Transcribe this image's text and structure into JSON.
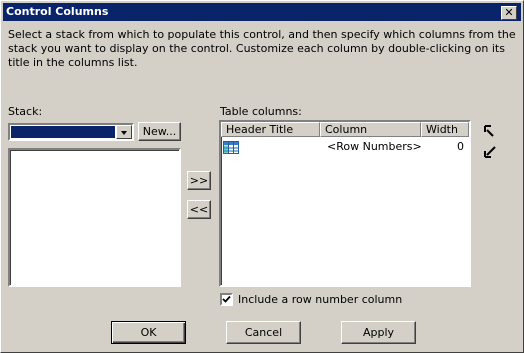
{
  "window": {
    "title": "Control Columns",
    "close_glyph": "✕"
  },
  "description": "Select a stack from which to populate this control, and then specify which columns from the stack you want to display on the control.  Customize each column by double-clicking on its title in the columns list.",
  "stack": {
    "label": "Stack:",
    "selected": "",
    "new_button": "New..."
  },
  "move": {
    "add_all": ">>",
    "remove_all": "<<"
  },
  "table_columns": {
    "label": "Table columns:",
    "headers": [
      "Header Title",
      "Column",
      "Width"
    ],
    "rows": [
      {
        "icon": "table-icon",
        "header_title": "",
        "column": "<Row Numbers>",
        "width": "0"
      }
    ]
  },
  "reorder": {
    "up_icon": "move-up-arrow-icon",
    "down_icon": "move-down-arrow-icon"
  },
  "row_number_checkbox": {
    "label": "Include a row number column",
    "checked": true
  },
  "buttons": {
    "ok": "OK",
    "cancel": "Cancel",
    "apply": "Apply"
  }
}
